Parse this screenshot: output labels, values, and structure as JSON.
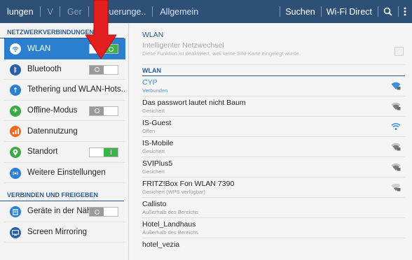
{
  "topbar": {
    "tabs": [
      {
        "label": "lungen",
        "state": "active"
      },
      {
        "label": "V",
        "state": "dim"
      },
      {
        "label": "Ger",
        "state": "dim"
      },
      {
        "label": "Steuerunge..",
        "state": "normal"
      },
      {
        "label": "Allgemein",
        "state": "normal"
      }
    ],
    "actions": {
      "search": "Suchen",
      "wifi_direct": "Wi-Fi Direct"
    }
  },
  "left": {
    "section1": "NETZWERKVERBINDUNGEN",
    "section2": "VERBINDEN UND FREIGEBEN",
    "items": [
      {
        "label": "WLAN",
        "icon": "wifi-icon",
        "color": "#2a80cf",
        "toggle": "on",
        "selected": true
      },
      {
        "label": "Bluetooth",
        "icon": "bluetooth-icon",
        "color": "#2d5fa8",
        "toggle": "off"
      },
      {
        "label": "Tethering und WLAN-Hots..",
        "icon": "tethering-icon",
        "color": "#2a7fd0",
        "toggle": null
      },
      {
        "label": "Offline-Modus",
        "icon": "airplane-icon",
        "color": "#3aa946",
        "toggle": "off"
      },
      {
        "label": "Datennutzung",
        "icon": "data-usage-icon",
        "color": "#ee6a1c",
        "toggle": null
      },
      {
        "label": "Standort",
        "icon": "location-icon",
        "color": "#3aa946",
        "toggle": "on"
      },
      {
        "label": "Weitere Einstellungen",
        "icon": "more-settings-icon",
        "color": "#2a7fd0",
        "toggle": null
      },
      {
        "label": "Geräte in der Näh..",
        "icon": "nearby-devices-icon",
        "color": "#2a7fd0",
        "toggle": "off"
      },
      {
        "label": "Screen Mirroring",
        "icon": "screen-mirroring-icon",
        "color": "#2d5fa8",
        "toggle": null
      }
    ]
  },
  "right": {
    "title": "WLAN",
    "smart_title": "Intelligenter Netzwechsel",
    "smart_sub": "Diese Funktion ist deaktiviert, weil keine SIM-Karte eingelegt wurde.",
    "section": "WLAN",
    "networks": [
      {
        "name": "CYP",
        "status": "Verbunden",
        "connected": true,
        "secured": true
      },
      {
        "name": "Das passwort lautet nicht Baum",
        "status": "Gesichert",
        "secured": true
      },
      {
        "name": "IS-Guest",
        "status": "Offen",
        "secured": false
      },
      {
        "name": "IS-Mobile",
        "status": "Gesichert",
        "secured": true
      },
      {
        "name": "SVIPlus5",
        "status": "Gesichert",
        "secured": true
      },
      {
        "name": "FRITZ!Box Fon WLAN 7390",
        "status": "Gesichert (WPS verfügbar)",
        "secured": true,
        "weak": true
      },
      {
        "name": "Callisto",
        "status": "Außerhalb des Bereichs",
        "out_of_range": true
      },
      {
        "name": "Hotel_Landhaus",
        "status": "Außerhalb des Bereichs",
        "out_of_range": true
      },
      {
        "name": "hotel_vezia",
        "status": "",
        "out_of_range": true
      }
    ]
  },
  "colors": {
    "topbar": "#2e4f76",
    "accent": "#2a80cf",
    "toggle_on": "#39b34a",
    "arrow": "#e41e1e"
  }
}
